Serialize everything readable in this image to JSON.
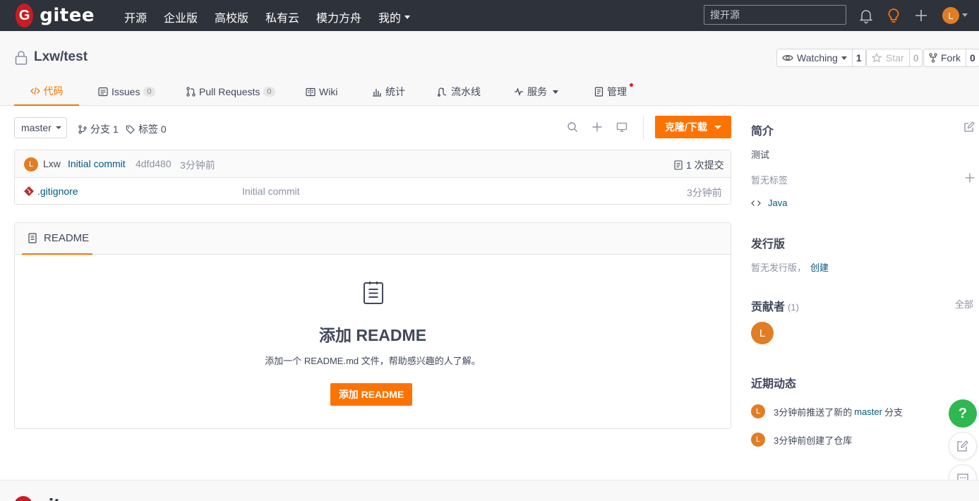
{
  "topnav": {
    "logo_text": "gitee",
    "links": [
      "开源",
      "企业版",
      "高校版",
      "私有云",
      "模力方舟",
      "我的"
    ],
    "search_placeholder": "搜开源",
    "avatar_letter": "L",
    "colors": {
      "bg": "#2e323b",
      "brand_red": "#c71d23",
      "accent": "#fe7300"
    }
  },
  "repo": {
    "name": "Lxw/test",
    "watch_label": "Watching",
    "watch_count": "1",
    "star_label": "Star",
    "star_count": "0",
    "fork_label": "Fork",
    "fork_count": "0"
  },
  "tabs": {
    "code": "代码",
    "issues": "Issues",
    "issues_count": "0",
    "pulls": "Pull Requests",
    "pulls_count": "0",
    "wiki": "Wiki",
    "stats": "统计",
    "pipeline": "流水线",
    "services": "服务",
    "manage": "管理"
  },
  "toolbar": {
    "branch": "master",
    "branches": "分支 1",
    "tags": "标签 0",
    "clone": "克隆/下载"
  },
  "commit": {
    "avatar": "L",
    "author": "Lxw",
    "message": "Initial commit",
    "hash": "4dfd480",
    "time": "3分钟前",
    "commits": "1 次提交"
  },
  "files": [
    {
      "name": ".gitignore",
      "message": "Initial commit",
      "time": "3分钟前"
    }
  ],
  "readme": {
    "tab": "README",
    "title": "添加 README",
    "desc": "添加一个 README.md 文件，帮助感兴趣的人了解。",
    "button": "添加 README"
  },
  "sidebar": {
    "intro_title": "简介",
    "intro_text": "测试",
    "no_tags": "暂无标签",
    "language": "Java",
    "release_title": "发行版",
    "release_text": "暂无发行版，",
    "release_create": "创建",
    "contrib_title": "贡献者",
    "contrib_count": "(1)",
    "contrib_all": "全部",
    "contrib_avatar": "L",
    "activity_title": "近期动态",
    "activity1_pre": "3分钟前推送了新的",
    "activity1_branch": "master",
    "activity1_post": "分支",
    "activity2": "3分钟前创建了仓库"
  },
  "float": {
    "help": "?"
  },
  "footer": {
    "logo_text": "gitee"
  }
}
